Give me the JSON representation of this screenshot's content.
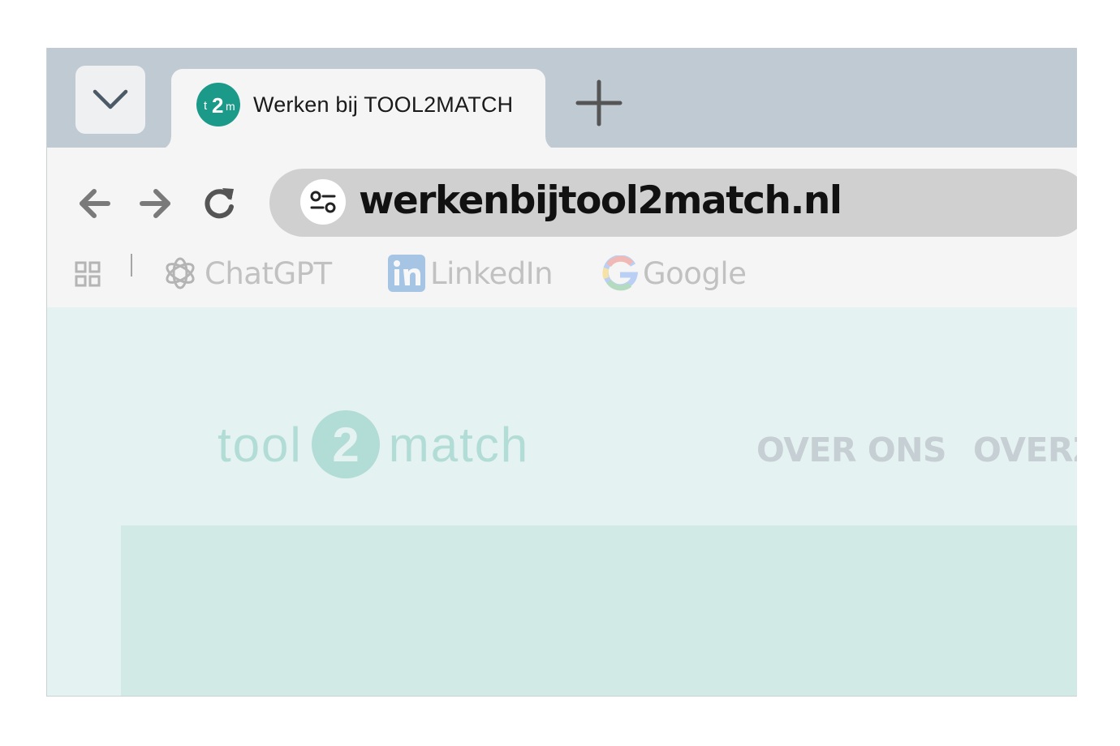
{
  "browser": {
    "tab": {
      "title": "Werken bij TOOL2MATCH",
      "favicon": "tool2match-logo-icon"
    },
    "tab_menu_icon": "chevron-down-icon",
    "new_tab_icon": "plus-icon",
    "toolbar": {
      "back_icon": "arrow-left-icon",
      "forward_icon": "arrow-right-icon",
      "reload_icon": "reload-icon"
    },
    "omnibox": {
      "site_info_icon": "tune-icon",
      "url": "werkenbijtool2match.nl"
    },
    "bookmarks": {
      "apps_icon": "apps-grid-icon",
      "items": [
        {
          "label": "ChatGPT",
          "icon": "openai-icon"
        },
        {
          "label": "LinkedIn",
          "icon": "linkedin-icon"
        },
        {
          "label": "Google",
          "icon": "google-icon"
        }
      ]
    }
  },
  "page": {
    "logo": {
      "left": "tool",
      "badge": "2",
      "right": "match"
    },
    "nav": [
      "OVER ONS",
      "OVERZ"
    ]
  },
  "colors": {
    "tabstrip": "#bfcad3",
    "toolbar": "#f5f5f5",
    "omnibox": "#d0d0d0",
    "page_bg": "#e5f2f2",
    "brand_teal": "#1b9a8a",
    "hero_block": "#d2eae6"
  }
}
